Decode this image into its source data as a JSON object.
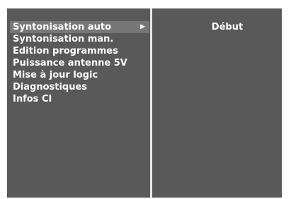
{
  "menu": {
    "items": [
      {
        "label": "Syntonisation auto",
        "selected": true,
        "has_submenu": true
      },
      {
        "label": "Syntonisation man."
      },
      {
        "label": "Edition programmes"
      },
      {
        "label": "Puissance antenne 5V"
      },
      {
        "label": "Mise à jour logic"
      },
      {
        "label": "Diagnostiques"
      },
      {
        "label": "Infos CI"
      }
    ],
    "submenu_arrow_icon": "▶"
  },
  "submenu": {
    "label": "Début"
  },
  "colors": {
    "panel_bg": "#595959",
    "highlight_bg": "#777777",
    "text": "#ffffff",
    "divider": "#e6e6e6"
  }
}
